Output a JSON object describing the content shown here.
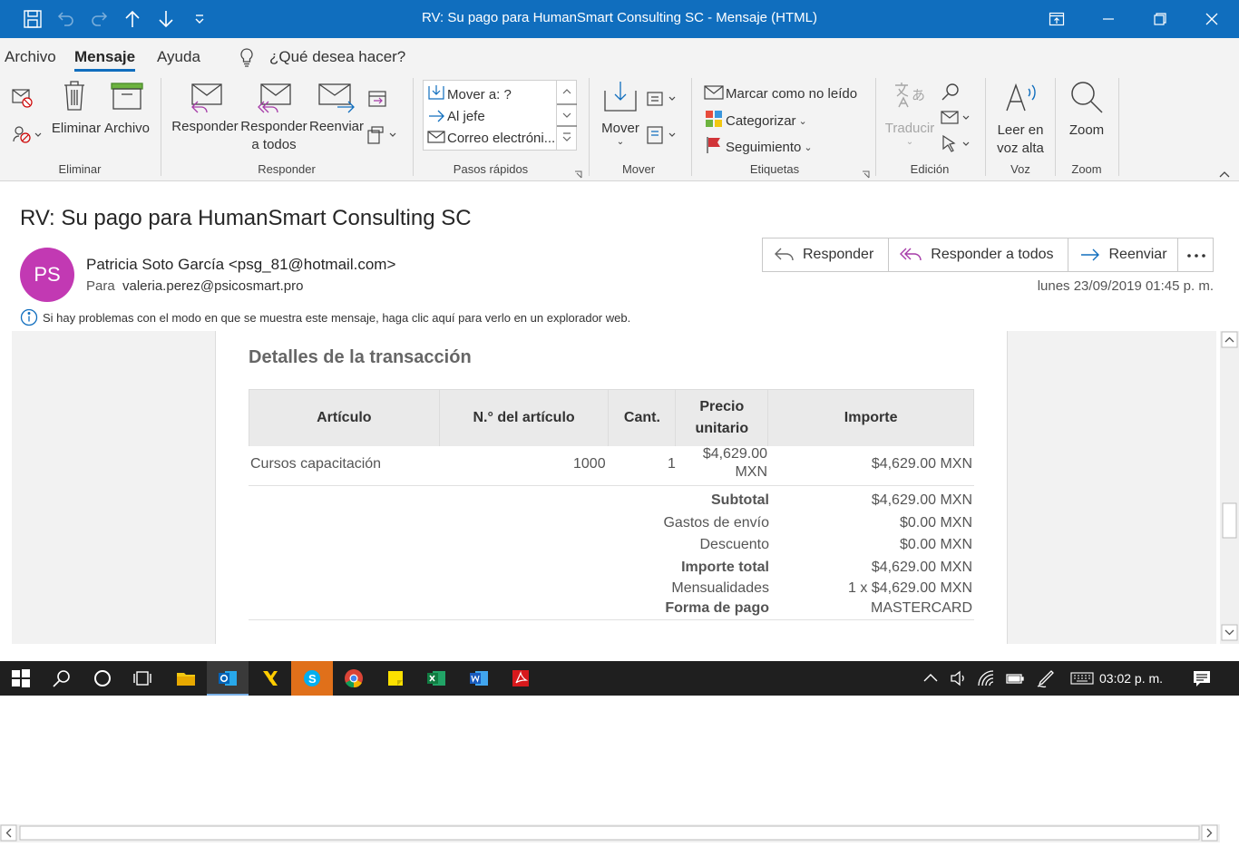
{
  "window": {
    "title": "RV: Su pago para HumanSmart Consulting SC  -  Mensaje (HTML)"
  },
  "menu": {
    "items": [
      "Archivo",
      "Mensaje",
      "Ayuda"
    ],
    "active": "Mensaje",
    "search_placeholder": "¿Qué desea hacer?"
  },
  "ribbon": {
    "eliminar": {
      "delete": "Eliminar",
      "archive": "Archivo",
      "group": "Eliminar"
    },
    "responder": {
      "reply": "Responder",
      "reply_all_1": "Responder",
      "reply_all_2": "a todos",
      "forward": "Reenviar",
      "group": "Responder"
    },
    "pasos_rapidos": {
      "items": [
        "Mover a: ?",
        "Al jefe",
        "Correo electróni..."
      ],
      "group": "Pasos rápidos"
    },
    "mover": {
      "move": "Mover",
      "group": "Mover"
    },
    "etiquetas": {
      "unread": "Marcar como no leído",
      "categorize": "Categorizar",
      "followup": "Seguimiento",
      "group": "Etiquetas"
    },
    "edicion": {
      "translate": "Traducir",
      "group": "Edición"
    },
    "voz": {
      "read_1": "Leer en",
      "read_2": "voz alta",
      "group": "Voz"
    },
    "zoom": {
      "zoom": "Zoom",
      "group": "Zoom"
    }
  },
  "message": {
    "subject": "RV: Su pago para HumanSmart Consulting SC",
    "avatar_initials": "PS",
    "avatar_color": "#c239b3",
    "from": "Patricia Soto García <psg_81@hotmail.com>",
    "to_label": "Para",
    "to": "valeria.perez@psicosmart.pro",
    "date": "lunes 23/09/2019 01:45 p. m.",
    "actions": {
      "reply": "Responder",
      "reply_all": "Responder a todos",
      "forward": "Reenviar"
    },
    "info": "Si hay problemas con el modo en que se muestra este mensaje, haga clic aquí para verlo en un explorador web."
  },
  "transaction": {
    "title": "Detalles de la transacción",
    "headers": {
      "item": "Artículo",
      "num": "N.° del artículo",
      "qty": "Cant.",
      "unit_1": "Precio",
      "unit_2": "unitario",
      "amount": "Importe"
    },
    "row": {
      "item": "Cursos capacitación",
      "num": "1000",
      "qty": "1",
      "unit_1": "$4,629.00",
      "unit_2": "MXN",
      "amount": "$4,629.00 MXN"
    },
    "summary": [
      {
        "label": "Subtotal",
        "value": "$4,629.00 MXN"
      },
      {
        "label": "Gastos de envío",
        "value": "$0.00 MXN"
      },
      {
        "label": "Descuento",
        "value": "$0.00 MXN"
      },
      {
        "label": "Importe total",
        "value": "$4,629.00 MXN"
      },
      {
        "label": "Mensualidades",
        "value": "1 x $4,629.00 MXN"
      },
      {
        "label": "Forma de pago",
        "value": "MASTERCARD"
      }
    ]
  },
  "taskbar": {
    "clock": "03:02 p. m."
  }
}
